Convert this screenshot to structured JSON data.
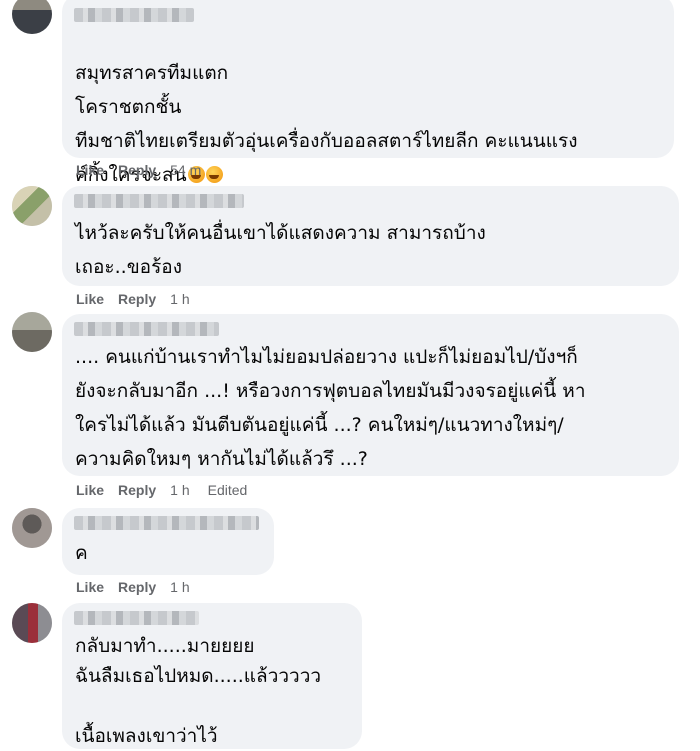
{
  "comments": [
    {
      "text": "สมุทรสาครทีมแตก\nโคราชตกชั้น\nทีมชาติไทยเตรียมตัวอุ่นเครื่องกับออลสตาร์ไทยลีก คะแนนแรง\nค์กิ้งใครจะสน",
      "emoji": [
        "rofl-emoji",
        "rofl-emoji"
      ],
      "actions": {
        "like": "Like",
        "reply": "Reply",
        "time": "54 m"
      }
    },
    {
      "text": "ไหว้ละครับให้คนอื่นเขาได้แสดงความ สามารถบ้าง\nเถอะ..ขอร้อง",
      "actions": {
        "like": "Like",
        "reply": "Reply",
        "time": "1 h"
      }
    },
    {
      "text": ".... คนแก่บ้านเราทำไมไม่ยอมปล่อยวาง แปะก็ไม่ยอมไป/บังฯก็\nยังจะกลับมาอีก ...! หรือวงการฟุตบอลไทยมันมีวงจรอยู่แค่นี้ หา\nใครไม่ได้แล้ว มันตีบตันอยู่แค่นี้ ...? คนใหม่ๆ/แนวทางใหม่ๆ/\nความคิดใหมๆ หากันไม่ได้แล้วรึ ...?",
      "actions": {
        "like": "Like",
        "reply": "Reply",
        "time": "1 h",
        "edited": "Edited"
      }
    },
    {
      "text": "ค",
      "actions": {
        "like": "Like",
        "reply": "Reply",
        "time": "1 h"
      }
    },
    {
      "text": "กลับมาทำ.....มายยยย\nฉันลืมเธอไปหมด.....แล้ววววว\n\nเนื้อเพลงเขาว่าไว้"
    }
  ],
  "colors": {
    "bubble": "#f0f2f5",
    "meta": "#65676b",
    "text": "#050505"
  }
}
